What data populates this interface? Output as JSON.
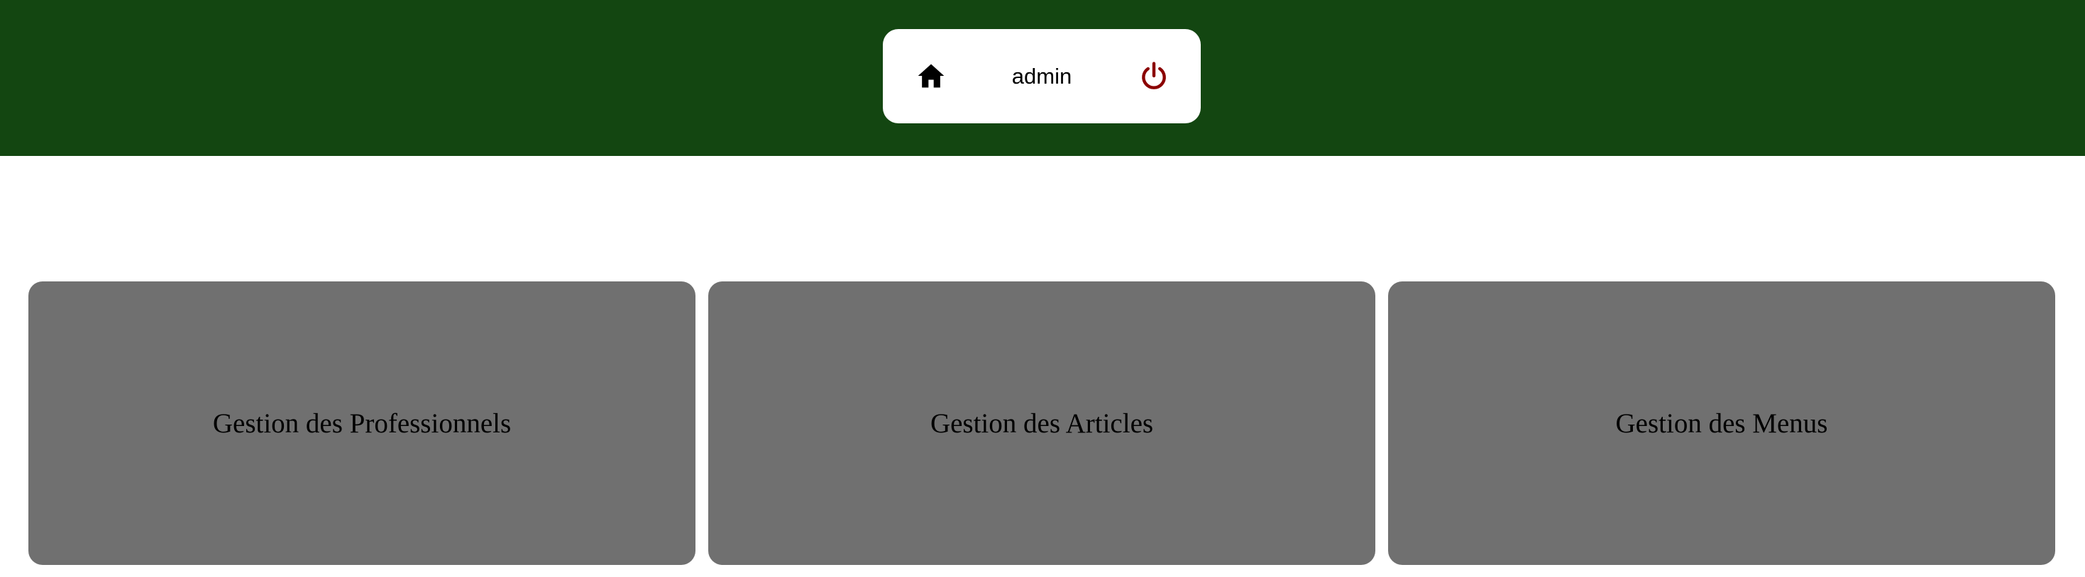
{
  "header": {
    "background_color": "#134611",
    "nav": {
      "home_icon": "home-icon",
      "username": "admin",
      "logout_icon": "power-icon",
      "logout_color": "#8b0000"
    }
  },
  "cards": [
    {
      "label": "Gestion des Professionnels"
    },
    {
      "label": "Gestion des Articles"
    },
    {
      "label": "Gestion des Menus"
    }
  ],
  "card_color": "#707070"
}
